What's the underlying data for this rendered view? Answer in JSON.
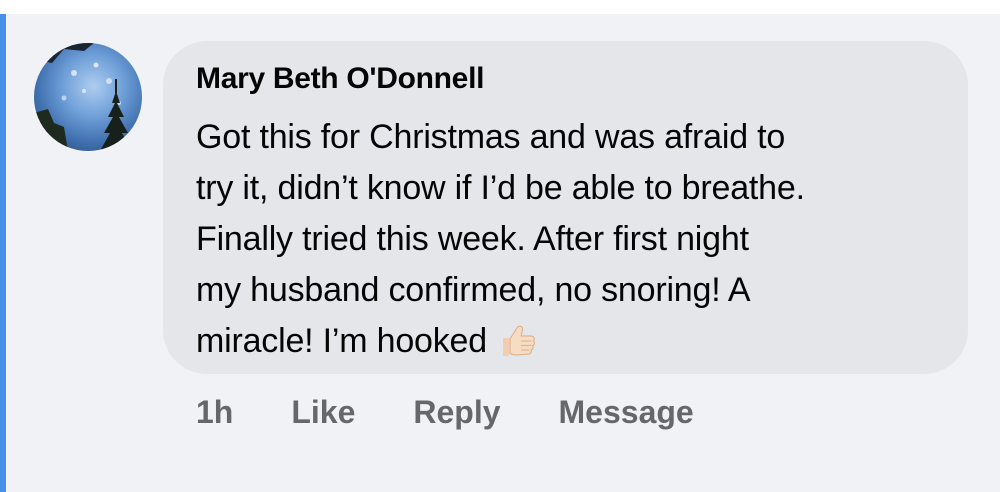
{
  "comment": {
    "author": "Mary Beth O'Donnell",
    "lines": [
      "Got this for Christmas and was afraid to",
      "try it, didn’t know if I’d be able to breathe.",
      "Finally tried this week. After first night",
      "my husband confirmed, no snoring! A",
      "miracle! I’m hooked"
    ],
    "emoji": "thumbs-up-icon",
    "timestamp": "1h",
    "actions": {
      "like": "Like",
      "reply": "Reply",
      "message": "Message"
    }
  },
  "colors": {
    "bubble": "#e4e6ea",
    "background": "#f0f2f5",
    "accent": "#4a8fe8",
    "text": "#050505",
    "secondary_text": "#65676b"
  }
}
